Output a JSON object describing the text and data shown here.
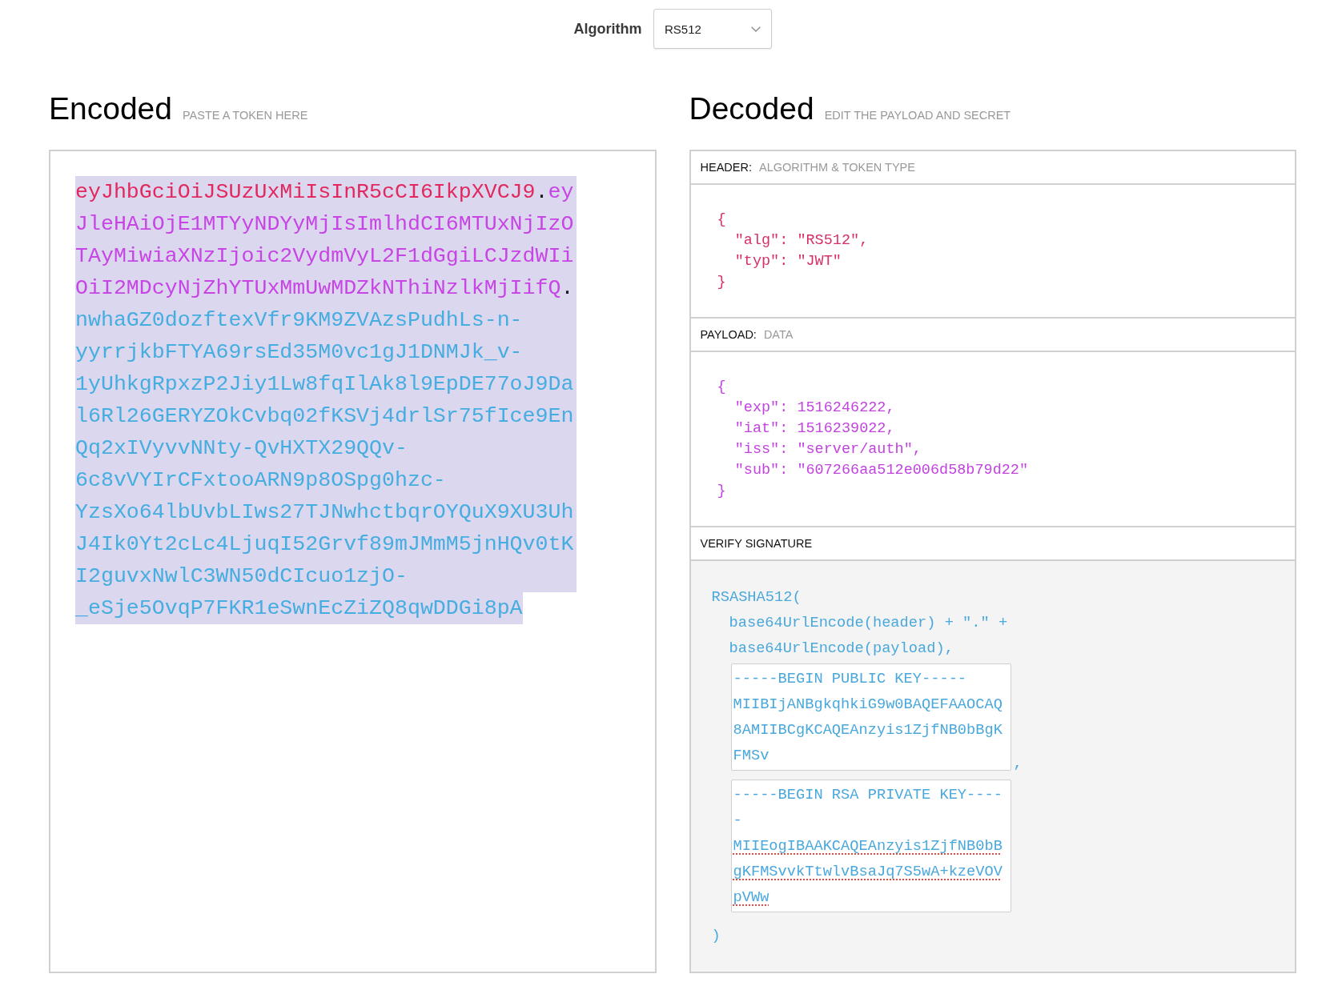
{
  "toolbar": {
    "label": "Algorithm",
    "algorithm_select": {
      "value": "RS512"
    }
  },
  "encoded": {
    "title": "Encoded",
    "subtitle": "PASTE A TOKEN HERE",
    "token": {
      "selected": true,
      "segments": [
        {
          "kind": "header",
          "text": "eyJhbGciOiJSUzUxMiIsInR5cCI6IkpXVCJ9"
        },
        {
          "kind": "dot",
          "text": "."
        },
        {
          "kind": "payload",
          "text": "eyJleHAiOjE1MTYyNDYyMjIsImlhdCI6MTUxNjIzOTAyMiwiaXNzIjoic2VydmVyL2F1dGgiLCJzdWIiOiI2MDcyNjZhYTUxMmUwMDZkNThiNzlkMjIifQ"
        },
        {
          "kind": "dot",
          "text": "."
        },
        {
          "kind": "signature",
          "text": "nwhaGZ0dozftexVfr9KM9ZVAzsPudhLs-n-yyrrjkbFTYA69rsEd35M0vc1gJ1DNMJk_v-1yUhkgRpxzP2Jiy1Lw8fqIlAk8l9EpDE77oJ9Dal6Rl26GERYZOkCvbq02fKSVj4drlSr75fIce9EnQq2xIVyvvNNty-QvHXTX29QQv-6c8vVYIrCFxtooARN9p8OSpg0hzc-YzsXo64lbUvbLIws27TJNwhctbqrOYQuX9XU3UhJ4Ik0Yt2cLc4LjuqI52Grvf89mJMmM5jnHQv0tKI2guvxNwlC3WN50dCIcuo1zjO-_eSje5OvqP7FKR1eSwnEcZiZQ8qwDDGi8pA"
        }
      ]
    }
  },
  "decoded": {
    "title": "Decoded",
    "subtitle": "EDIT THE PAYLOAD AND SECRET",
    "sections": [
      {
        "kind": "header_json",
        "label": "HEADER:",
        "sublabel": "ALGORITHM & TOKEN TYPE",
        "code": "{\n  \"alg\": \"RS512\",\n  \"typ\": \"JWT\"\n}"
      },
      {
        "kind": "payload_json",
        "label": "PAYLOAD:",
        "sublabel": "DATA",
        "code": "{\n  \"exp\": 1516246222,\n  \"iat\": 1516239022,\n  \"iss\": \"server/auth\",\n  \"sub\": \"607266aa512e006d58b79d22\"\n}"
      },
      {
        "kind": "signature",
        "label": "VERIFY SIGNATURE",
        "function_line": "RSASHA512(",
        "argument_lines": [
          "base64UrlEncode(header) + \".\" +",
          "base64UrlEncode(payload),"
        ],
        "public_key": {
          "begin_line": "-----BEGIN PUBLIC KEY-----",
          "body": "MIIBIjANBgkqhkiG9w0BAQEFAAOCAQ8AMIIBCgKCAQEAnzyis1ZjfNB0bBgKFMSv",
          "spellcheck_marked": false
        },
        "separator": ",",
        "private_key": {
          "begin_line": "-----BEGIN RSA PRIVATE KEY-----",
          "body": "MIIEogIBAAKCAQEAnzyis1ZjfNB0bBgKFMSvvkTtwlvBsaJq7S5wA+kzeVOVpVWw",
          "spellcheck_marked": true
        },
        "closing": ")"
      }
    ]
  }
}
